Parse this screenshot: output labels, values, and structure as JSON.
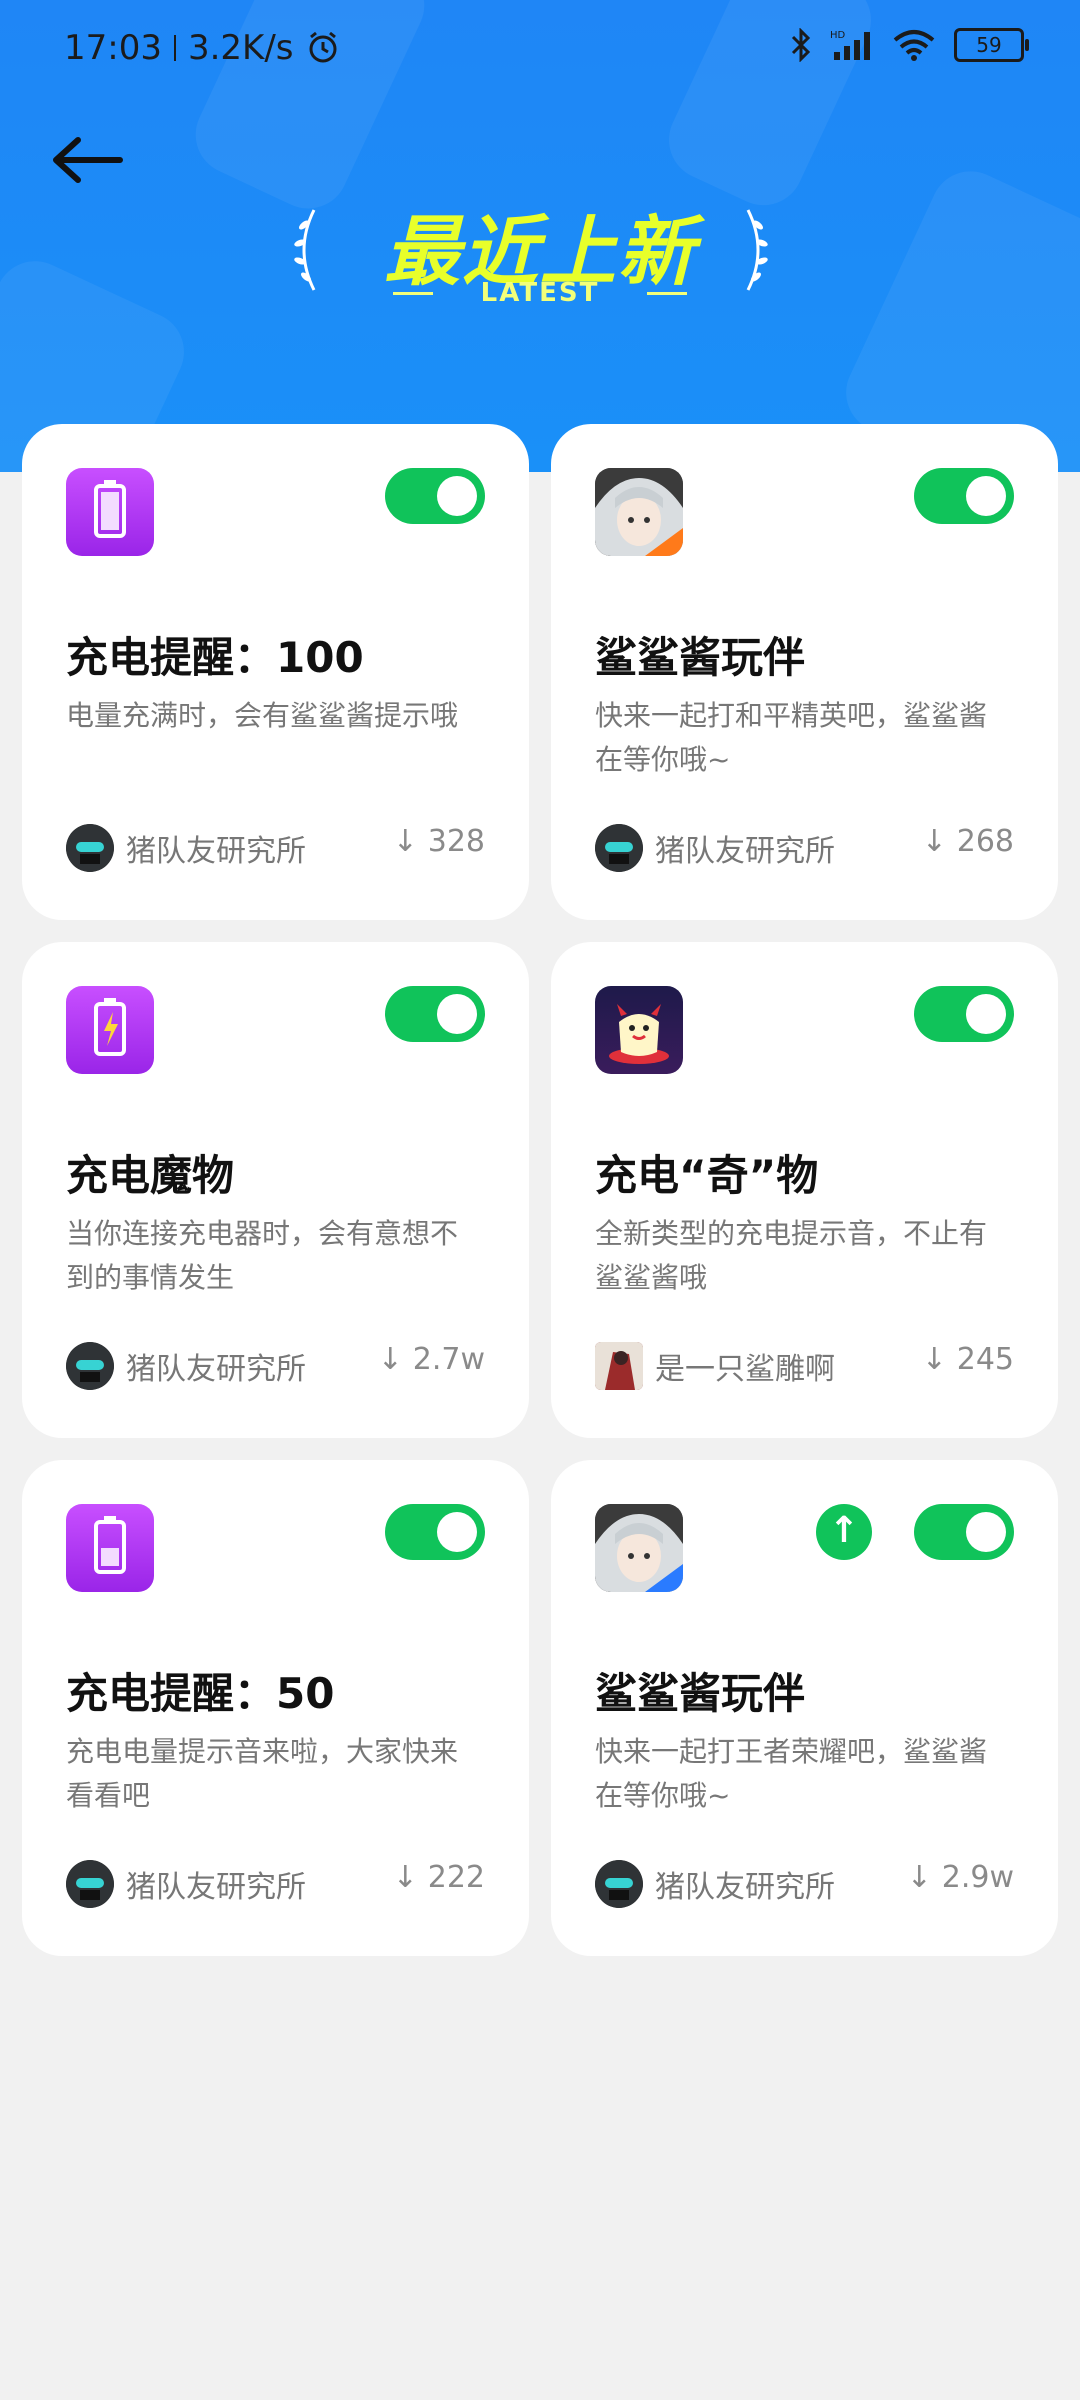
{
  "status_bar": {
    "time": "17:03",
    "network_speed": "3.2K/s",
    "alarm_icon": "alarm-icon",
    "bluetooth_icon": "bluetooth-icon",
    "signal_label": "HD",
    "wifi_icon": "wifi-icon",
    "battery": "59"
  },
  "header": {
    "title": "最近上新",
    "subtitle": "LATEST",
    "back_icon": "back-arrow-icon"
  },
  "colors": {
    "hero_blue": "#1f86f6",
    "accent_yellow": "#e8ff2a",
    "toggle_green": "#10c35a"
  },
  "items": [
    {
      "title": "充电提醒：100",
      "description": "电量充满时，会有鲨鲨酱提示哦",
      "author": "猪队友研究所",
      "downloads": "328",
      "icon": "battery-full-icon",
      "enabled": true
    },
    {
      "title": "鲨鲨酱玩伴",
      "description": "快来一起打和平精英吧，鲨鲨酱在等你哦~",
      "author": "猪队友研究所",
      "downloads": "268",
      "icon": "anime-girl-orange-icon",
      "enabled": true
    },
    {
      "title": "充电魔物",
      "description": "当你连接充电器时，会有意想不到的事情发生",
      "author": "猪队友研究所",
      "downloads": "2.7w",
      "icon": "battery-bolt-icon",
      "enabled": true
    },
    {
      "title": "充电“奇”物",
      "description": "全新类型的充电提示音，不止有鲨鲨酱哦",
      "author": "是一只鲨雕啊",
      "downloads": "245",
      "icon": "little-devil-icon",
      "enabled": true
    },
    {
      "title": "充电提醒：50",
      "description": "充电电量提示音来啦，大家快来看看吧",
      "author": "猪队友研究所",
      "downloads": "222",
      "icon": "battery-half-icon",
      "enabled": true
    },
    {
      "title": "鲨鲨酱玩伴",
      "description": "快来一起打王者荣耀吧，鲨鲨酱在等你哦~",
      "author": "猪队友研究所",
      "downloads": "2.9w",
      "icon": "anime-girl-blue-icon",
      "enabled": true,
      "has_update": true
    }
  ]
}
